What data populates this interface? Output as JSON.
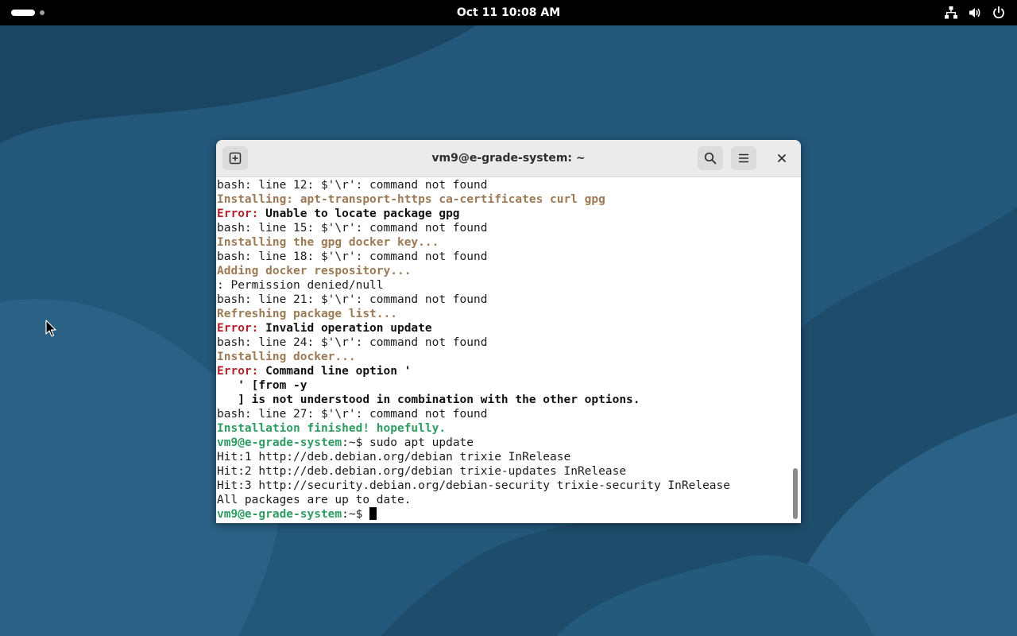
{
  "topbar": {
    "clock": "Oct 11  10:08 AM",
    "icons": [
      "network-icon",
      "volume-icon",
      "power-icon"
    ]
  },
  "window": {
    "title": "vm9@e-grade-system: ~",
    "buttons": [
      "new-tab-icon",
      "search-icon",
      "hamburger-menu-icon",
      "close-icon"
    ]
  },
  "terminal": {
    "lines": [
      [
        {
          "t": "bash: line 12: $'\\r': command not found",
          "c": "plain"
        }
      ],
      [
        {
          "t": "Installing: apt-transport-https ca-certificates curl gpg",
          "c": "info"
        }
      ],
      [
        {
          "t": "Error: ",
          "c": "err"
        },
        {
          "t": "Unable to locate package gpg",
          "c": "errmsg"
        }
      ],
      [
        {
          "t": "bash: line 15: $'\\r': command not found",
          "c": "plain"
        }
      ],
      [
        {
          "t": "Installing the gpg docker key...",
          "c": "info"
        }
      ],
      [
        {
          "t": "bash: line 18: $'\\r': command not found",
          "c": "plain"
        }
      ],
      [
        {
          "t": "Adding docker respository...",
          "c": "info"
        }
      ],
      [
        {
          "t": ": Permission denied/null",
          "c": "plain"
        }
      ],
      [
        {
          "t": "bash: line 21: $'\\r': command not found",
          "c": "plain"
        }
      ],
      [
        {
          "t": "Refreshing package list...",
          "c": "info"
        }
      ],
      [
        {
          "t": "Error: ",
          "c": "err"
        },
        {
          "t": "Invalid operation update",
          "c": "errmsg"
        }
      ],
      [
        {
          "t": "bash: line 24: $'\\r': command not found",
          "c": "plain"
        }
      ],
      [
        {
          "t": "Installing docker...",
          "c": "info"
        }
      ],
      [
        {
          "t": "Error: ",
          "c": "err"
        },
        {
          "t": "Command line option '",
          "c": "errmsg"
        }
      ],
      [
        {
          "t": "   ' [from -y",
          "c": "errmsg"
        }
      ],
      [
        {
          "t": "   ] is not understood in combination with the other options.",
          "c": "errmsg"
        }
      ],
      [
        {
          "t": "bash: line 27: $'\\r': command not found",
          "c": "plain"
        }
      ],
      [
        {
          "t": "Installation finished! hopefully.",
          "c": "success"
        }
      ],
      [
        {
          "t": "vm9@e-grade-system",
          "c": "user"
        },
        {
          "t": ":~$ sudo apt update",
          "c": "plain"
        }
      ],
      [
        {
          "t": "Hit:1 http://deb.debian.org/debian trixie InRelease",
          "c": "plain"
        }
      ],
      [
        {
          "t": "Hit:2 http://deb.debian.org/debian trixie-updates InRelease",
          "c": "plain"
        }
      ],
      [
        {
          "t": "Hit:3 http://security.debian.org/debian-security trixie-security InRelease",
          "c": "plain"
        }
      ],
      [
        {
          "t": "All packages are up to date.",
          "c": "plain"
        }
      ],
      [
        {
          "t": "vm9@e-grade-system",
          "c": "user"
        },
        {
          "t": ":~$ ",
          "c": "plain"
        }
      ]
    ]
  },
  "colors": {
    "info": "#9c7a55",
    "error": "#b3202a",
    "success": "#2f9c62",
    "topbar": "#000000",
    "wallpaper": "#1f4f6e"
  }
}
